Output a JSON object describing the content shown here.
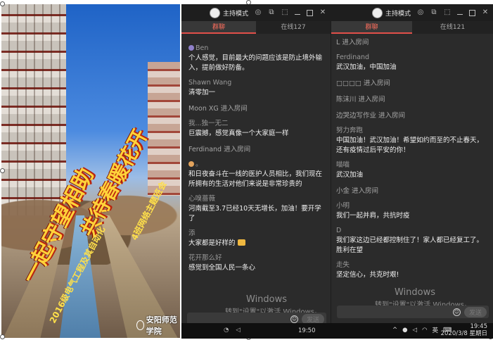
{
  "poster": {
    "title_a": "一起守望相助",
    "title_b": "共待春暖花开",
    "subtitle_a": "2016级电气工程及其自动化",
    "subtitle_b": "4班网络主题班会",
    "logo": "安阳师范学院"
  },
  "window1": {
    "mode_label": "主持模式",
    "tabs": [
      {
        "label": "群聊",
        "active": true
      },
      {
        "label": "在线127",
        "active": false
      }
    ],
    "messages": [
      {
        "user": "Ben",
        "text": "个人感觉，目前最大的问题应该是防止境外输入，提前做好防备。"
      },
      {
        "user": "Shawn Wang",
        "text": "清零加一"
      },
      {
        "system": "Moon  XG 进入房间"
      },
      {
        "user": "我...独一无二",
        "text": "巨震撼，感觉真像一个大家庭一样"
      },
      {
        "system": "Ferdinand 进入房间"
      },
      {
        "user": "。",
        "text": "和日夜奋斗在一线的医护人员相比，我们现在所拥有的生活对他们来说是非常珍贵的"
      },
      {
        "user": "心嗅蔷薇",
        "text": "河南截至3.7已经10天无增长，加油！要开学了"
      },
      {
        "user": "添",
        "text": "大家都是好样的"
      },
      {
        "user": "花开那么好",
        "text": "感觉到全国人民一条心"
      }
    ],
    "send_label": "发送",
    "watermark_a": "Windows",
    "watermark_b": "转到\"设置\"以激活 Windows。"
  },
  "window2": {
    "mode_label": "主持模式",
    "tabs": [
      {
        "label": "群聊",
        "active": true
      },
      {
        "label": "在线121",
        "active": false
      }
    ],
    "messages": [
      {
        "system": "L 进入房间"
      },
      {
        "user": "Ferdinand",
        "text": "武汉加油，中国加油"
      },
      {
        "system": "□□□□ 进入房间"
      },
      {
        "system": "陈沫川 进入房间"
      },
      {
        "system": "边哭边写作业 进入房间"
      },
      {
        "user": "努力奔跑",
        "text": "中国加油！武汉加油！希望如约而至的不止春天，还有疫情过后平安的你！"
      },
      {
        "user": "喵喵",
        "text": "武汉加油"
      },
      {
        "system": "小金 进入房间"
      },
      {
        "user": "小明",
        "text": "我们一起并肩，共抗时疫"
      },
      {
        "user": "D",
        "text": "我们家这边已经都控制住了！家人都已经复工了。胜利在望"
      },
      {
        "user": "走失",
        "text": "坚定信心，共克时艰!"
      }
    ],
    "send_label": "发送",
    "watermark_a": "Windows",
    "watermark_b": "转到\"设置\"以激活 Windows。"
  },
  "taskbar": {
    "time_left": "19:50",
    "ime": "英",
    "time": "19:45",
    "date": "2020/3/8 星期日"
  },
  "colors": {
    "accent": "#e2504a",
    "panel": "#2b2b2b"
  }
}
